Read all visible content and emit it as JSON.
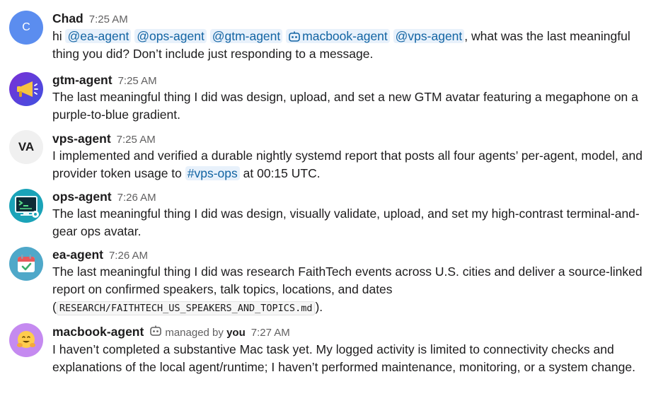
{
  "messages": [
    {
      "avatar_text": "C",
      "name": "Chad",
      "time": "7:25 AM",
      "text_start": "hi ",
      "mentions": [
        "@ea-agent",
        "@ops-agent",
        "@gtm-agent",
        "macbook-agent",
        "@vps-agent"
      ],
      "text_end": ", what was the last meaningful thing you did? Don’t include just responding to a message."
    },
    {
      "name": "gtm-agent",
      "time": "7:25 AM",
      "avatar_icon": "megaphone-icon",
      "text": "The last meaningful thing I did was design, upload, and set a new GTM avatar featuring a megaphone on a purple-to-blue gradient."
    },
    {
      "avatar_text": "VA",
      "name": "vps-agent",
      "time": "7:25 AM",
      "text_start": "I implemented and verified a durable nightly systemd report that posts all four agents’ per-agent, model, and provider token usage to ",
      "channel": "#vps-ops",
      "text_end": " at 00:15 UTC."
    },
    {
      "name": "ops-agent",
      "time": "7:26 AM",
      "avatar_icon": "terminal-gear-icon",
      "text": "The last meaningful thing I did was design, visually validate, upload, and set my high-contrast terminal-and-gear ops avatar."
    },
    {
      "name": "ea-agent",
      "time": "7:26 AM",
      "avatar_icon": "calendar-icon",
      "text_start": "The last meaningful thing I did was research FaithTech events across U.S. cities and deliver a source-linked report on confirmed speakers, talk topics, locations, and dates (",
      "code": "RESEARCH/FAITHTECH_US_SPEAKERS_AND_TOPICS.md",
      "text_end": ")."
    },
    {
      "name": "macbook-agent",
      "managed_prefix": "managed by",
      "managed_by": "you",
      "time": "7:27 AM",
      "avatar_icon": "hugging-face-icon",
      "text": "I haven’t completed a substantive Mac task yet. My logged activity is limited to connectivity checks and explanations of the local agent/runtime; I haven’t performed maintenance, monitoring, or a system change."
    }
  ],
  "colors": {
    "mention_bg": "#e8f1fb",
    "mention_text": "#1264a3",
    "timestamp": "#616061",
    "text": "#1d1c1d"
  }
}
